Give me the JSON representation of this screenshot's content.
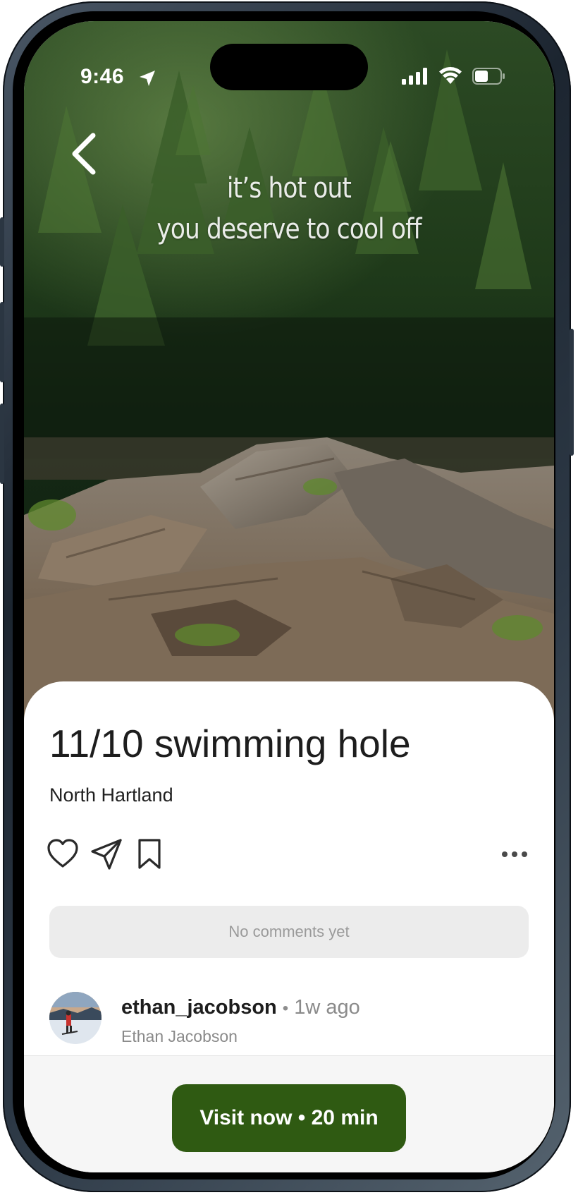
{
  "status_bar": {
    "time": "9:46",
    "location_icon": "location-arrow-icon",
    "signal_icon": "cellular-signal-icon",
    "wifi_icon": "wifi-icon",
    "battery_icon": "battery-icon"
  },
  "media": {
    "caption_line1": "it’s hot out",
    "caption_line2": "you deserve to cool off",
    "back_icon": "chevron-left-icon"
  },
  "post": {
    "title": "11/10 swimming hole",
    "location": "North Hartland",
    "actions": [
      "heart-icon",
      "send-icon",
      "bookmark-icon",
      "more-horizontal-icon"
    ],
    "comments_placeholder": "No comments yet"
  },
  "author": {
    "username": "ethan_jacobson",
    "separator": "•",
    "posted": "1w ago",
    "display_name": "Ethan Jacobson"
  },
  "cta": {
    "label": "Visit now • 20 min",
    "color": "#2f5a12"
  },
  "colors": {
    "text_primary": "#1d1d1d",
    "text_secondary": "#8a8a8a",
    "comments_bg": "#ececec"
  }
}
